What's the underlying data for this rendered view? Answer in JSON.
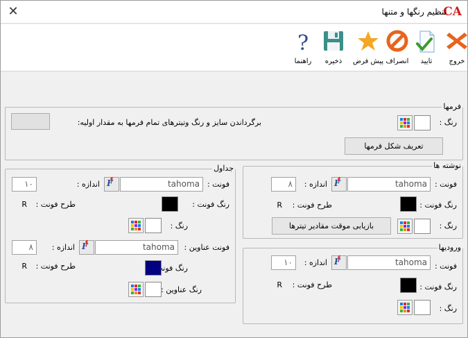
{
  "window": {
    "title": "تنظیم رنگها و متنها",
    "logo_text": "CA"
  },
  "toolbar": {
    "exit": "خروج",
    "confirm": "تایید",
    "cancel": "انصراف",
    "default": "پیش فرض",
    "save": "ذخیره",
    "help": "راهنما"
  },
  "forms": {
    "title": "فرمها",
    "color_label": "رنگ :",
    "reset_label": "برگرداندن سایز و رنگ وتیترهای تمام فرمها به مقدار اولیه:",
    "define_button": "تعریف شکل فرمها"
  },
  "texts": {
    "title": "نوشته ها",
    "font_label": "فونت :",
    "font_value": "tahoma",
    "size_label": "اندازه :",
    "size_value": "۸",
    "font_color_label": "رنگ فونت :",
    "font_style_label": "طرح فونت :",
    "font_style_value": "R",
    "color_label": "رنگ :",
    "restore_button": "بازیابی موقت مقادیر تیترها",
    "font_color": "#000000"
  },
  "inputs": {
    "title": "ورودیها",
    "font_label": "فونت :",
    "font_value": "tahoma",
    "size_label": "اندازه :",
    "size_value": "۱۰",
    "font_color_label": "رنگ فونت :",
    "font_style_label": "طرح فونت :",
    "font_style_value": "R",
    "color_label": "رنگ :",
    "font_color": "#000000"
  },
  "tables": {
    "title": "جداول",
    "font_label": "فونت :",
    "font_value": "tahoma",
    "size_label": "اندازه :",
    "size_value": "۱۰",
    "font_color_label": "رنگ فونت :",
    "font_style_label": "طرح فونت :",
    "font_style_value": "R",
    "color_label": "رنگ :",
    "header_font_label": "فونت عناوین :",
    "header_font_value": "tahoma",
    "header_size_label": "اندازه :",
    "header_size_value": "۸",
    "header_font_color_label": "رنگ فونت :",
    "header_font_style_label": "طرح فونت :",
    "header_font_style_value": "R",
    "header_color_label": "رنگ عناوین :",
    "font_color": "#000000",
    "header_font_color": "#000080"
  }
}
